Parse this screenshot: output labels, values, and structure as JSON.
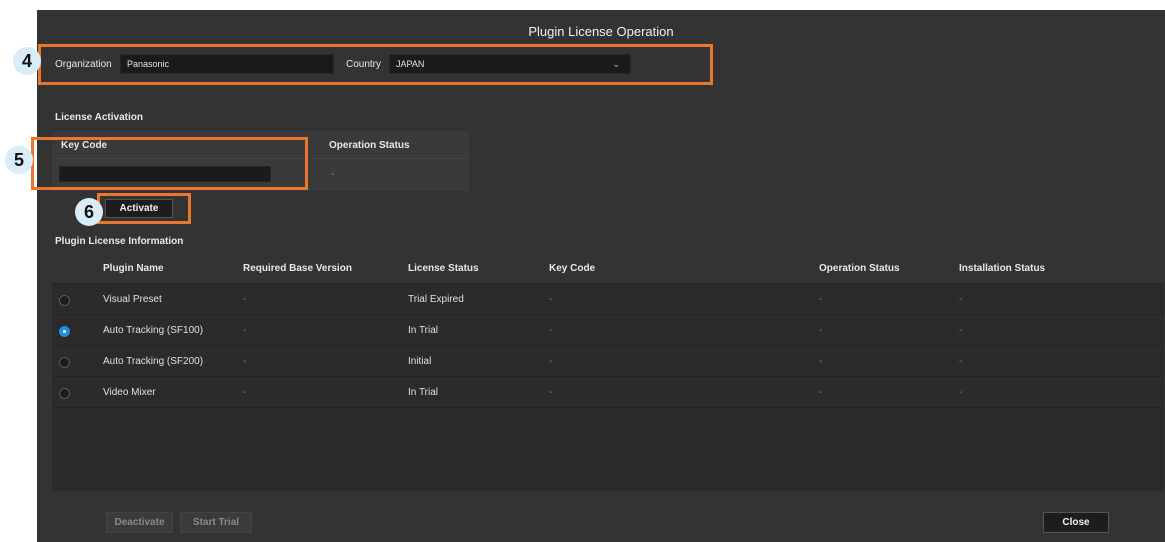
{
  "window": {
    "title": "Plugin License Operation"
  },
  "organization": {
    "label": "Organization",
    "value": "Panasonic"
  },
  "country": {
    "label": "Country",
    "value": "JAPAN"
  },
  "license_activation": {
    "section_label": "License Activation",
    "key_code_label": "Key Code",
    "key_code_value": "",
    "operation_status_label": "Operation Status",
    "operation_status_value": "-",
    "activate_label": "Activate"
  },
  "plugin_info": {
    "section_label": "Plugin License Information",
    "columns": [
      "Plugin Name",
      "Required Base Version",
      "License Status",
      "Key Code",
      "Operation Status",
      "Installation Status"
    ],
    "rows": [
      {
        "selected": false,
        "plugin_name": "Visual Preset",
        "required_base_version": "-",
        "license_status": "Trial Expired",
        "key_code": "-",
        "operation_status": "-",
        "installation_status": "-"
      },
      {
        "selected": true,
        "plugin_name": "Auto Tracking (SF100)",
        "required_base_version": "-",
        "license_status": "In Trial",
        "key_code": "-",
        "operation_status": "-",
        "installation_status": "-"
      },
      {
        "selected": false,
        "plugin_name": "Auto Tracking (SF200)",
        "required_base_version": "-",
        "license_status": "Initial",
        "key_code": "-",
        "operation_status": "-",
        "installation_status": "-"
      },
      {
        "selected": false,
        "plugin_name": "Video Mixer",
        "required_base_version": "-",
        "license_status": "In Trial",
        "key_code": "-",
        "operation_status": "-",
        "installation_status": "-"
      }
    ]
  },
  "footer": {
    "deactivate_label": "Deactivate",
    "start_trial_label": "Start Trial",
    "close_label": "Close"
  },
  "callouts": [
    "4",
    "5",
    "6"
  ],
  "colors": {
    "window_bg": "#333333",
    "highlight": "#e7782c",
    "radio_selected": "#1f8fe0",
    "callout_badge": "#d9ecfa"
  },
  "icons": {
    "country_dropdown": "chevron-down-icon",
    "row_select": "radio-button-icon"
  }
}
